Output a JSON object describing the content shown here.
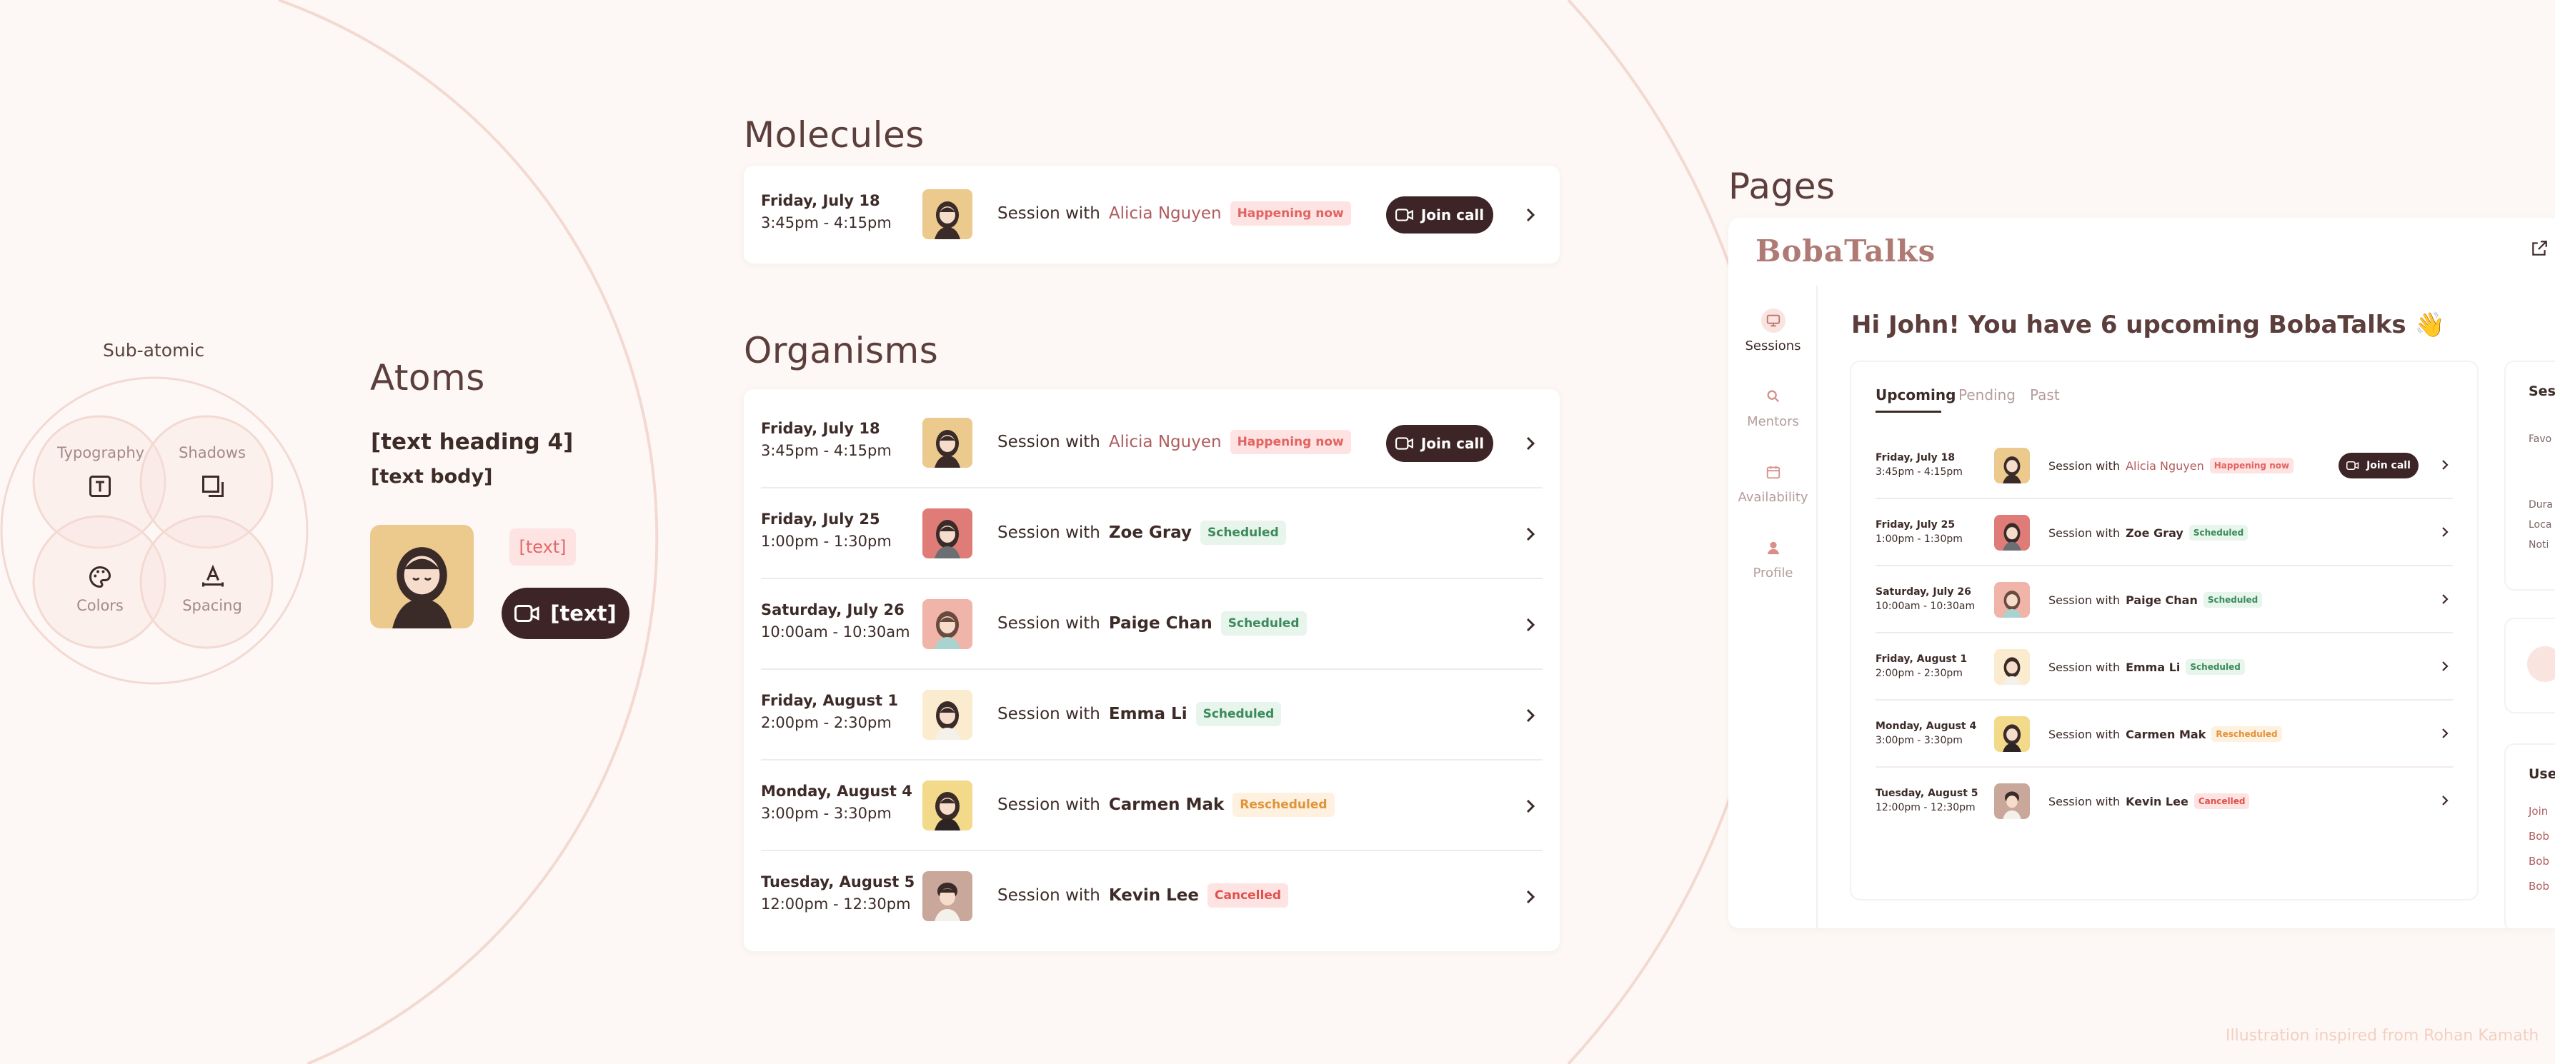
{
  "sections": {
    "subatomic": "Sub-atomic",
    "atoms": "Atoms",
    "molecules": "Molecules",
    "organisms": "Organisms",
    "pages": "Pages"
  },
  "subatomic": {
    "typography": "Typography",
    "shadows": "Shadows",
    "colors": "Colors",
    "spacing": "Spacing"
  },
  "atoms": {
    "heading": "[text heading 4]",
    "body": "[text body]",
    "badge": "[text]",
    "button": "[text]"
  },
  "session_prefix": "Session with",
  "join_label": "Join call",
  "sessions": [
    {
      "day": "Friday, July 18",
      "time": "3:45pm - 4:15pm",
      "mentor": "Alicia Nguyen",
      "status": "Happening now",
      "status_color": "#e36361",
      "join": true
    },
    {
      "day": "Friday, July 25",
      "time": "1:00pm - 1:30pm",
      "mentor": "Zoe Gray",
      "status": "Scheduled",
      "status_color": "#3b8a5a",
      "join": false
    },
    {
      "day": "Saturday, July 26",
      "time": "10:00am - 10:30am",
      "mentor": "Paige Chan",
      "status": "Scheduled",
      "status_color": "#3b8a5a",
      "join": false
    },
    {
      "day": "Friday, August 1",
      "time": "2:00pm - 2:30pm",
      "mentor": "Emma Li",
      "status": "Scheduled",
      "status_color": "#3b8a5a",
      "join": false
    },
    {
      "day": "Monday, August 4",
      "time": "3:00pm - 3:30pm",
      "mentor": "Carmen Mak",
      "status": "Rescheduled",
      "status_color": "#e0933a",
      "join": false
    },
    {
      "day": "Tuesday, August 5",
      "time": "12:00pm - 12:30pm",
      "mentor": "Kevin Lee",
      "status": "Cancelled",
      "status_color": "#e0504c",
      "join": false
    }
  ],
  "app": {
    "logo": "BobaTalks",
    "greeting": "Hi John! You have 6 upcoming BobaTalks 👋",
    "nav": [
      "Sessions",
      "Mentors",
      "Availability",
      "Profile"
    ],
    "tabs": [
      "Upcoming",
      "Pending",
      "Past"
    ],
    "right_panel": {
      "title_partial": "Ses",
      "fav_partial": "Favo",
      "meta_partials": [
        "Dura",
        "Loca",
        "Noti"
      ],
      "useful_partial": "Use",
      "link_partials": [
        "Join",
        "Bob",
        "Bob",
        "Bob"
      ]
    }
  },
  "credit": "Illustration inspired from Rohan Kamath",
  "colors": {
    "background": "#fdf8f5",
    "accent_dark": "#3d2426",
    "pink": "#b05c5e",
    "arc": "#f3d9d2"
  }
}
